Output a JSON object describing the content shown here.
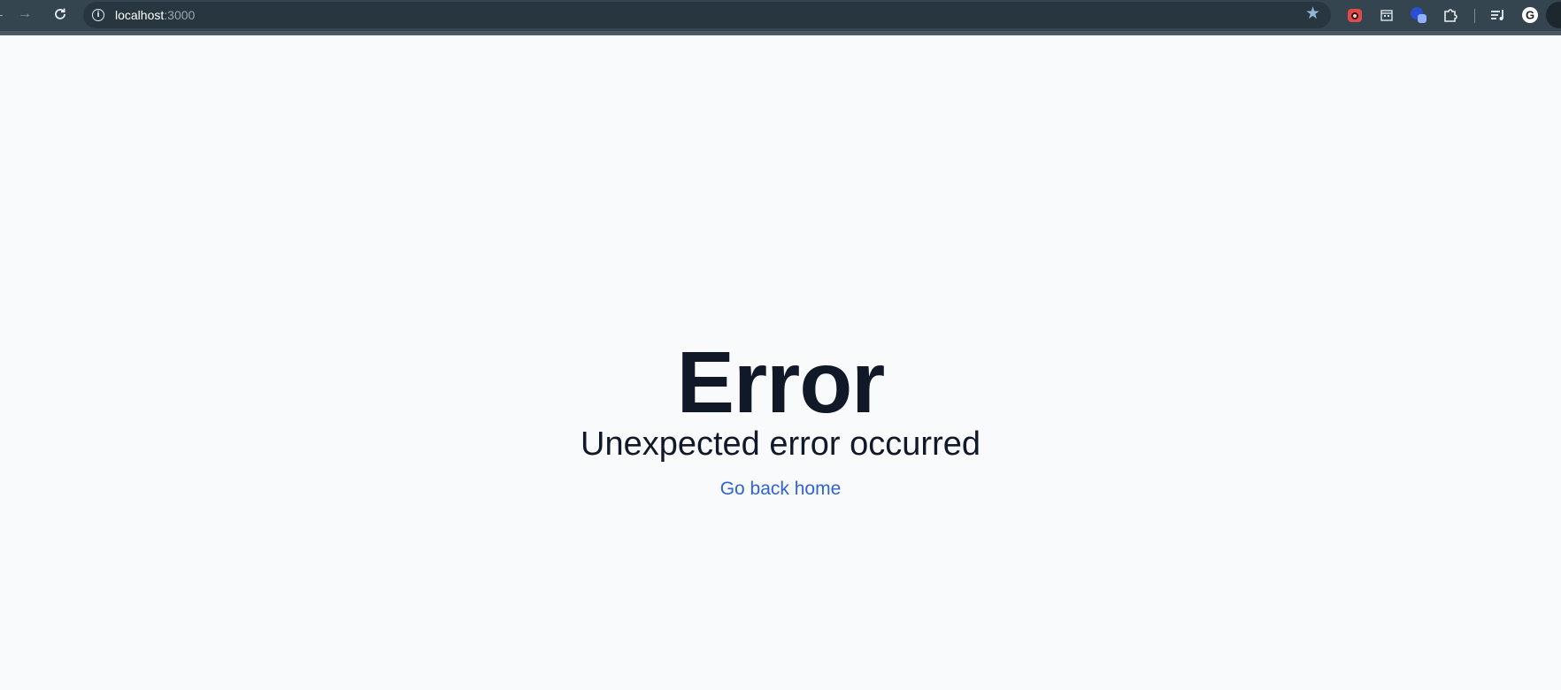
{
  "browser": {
    "url_host": "localhost",
    "url_port": ":3000",
    "icons": {
      "back": "arrow-left-icon",
      "forward": "arrow-right-icon",
      "reload": "reload-icon",
      "site_info": "info-icon",
      "bookmark": "star-icon",
      "extensions": [
        "ext-red-icon",
        "ext-calendar-icon",
        "ext-blue-icon",
        "puzzle-icon"
      ],
      "reading_list": "reading-list-icon",
      "google": "google-icon",
      "profile": "avatar"
    },
    "colors": {
      "toolbar": "#35454f",
      "omnibox": "#27363f",
      "star": "#8fb6d6"
    }
  },
  "page": {
    "title": "Error",
    "subtitle": "Unexpected error occurred",
    "home_link": "Go back home",
    "colors": {
      "background": "#f8fafc",
      "text": "#111827",
      "link": "#2f63d6"
    }
  }
}
